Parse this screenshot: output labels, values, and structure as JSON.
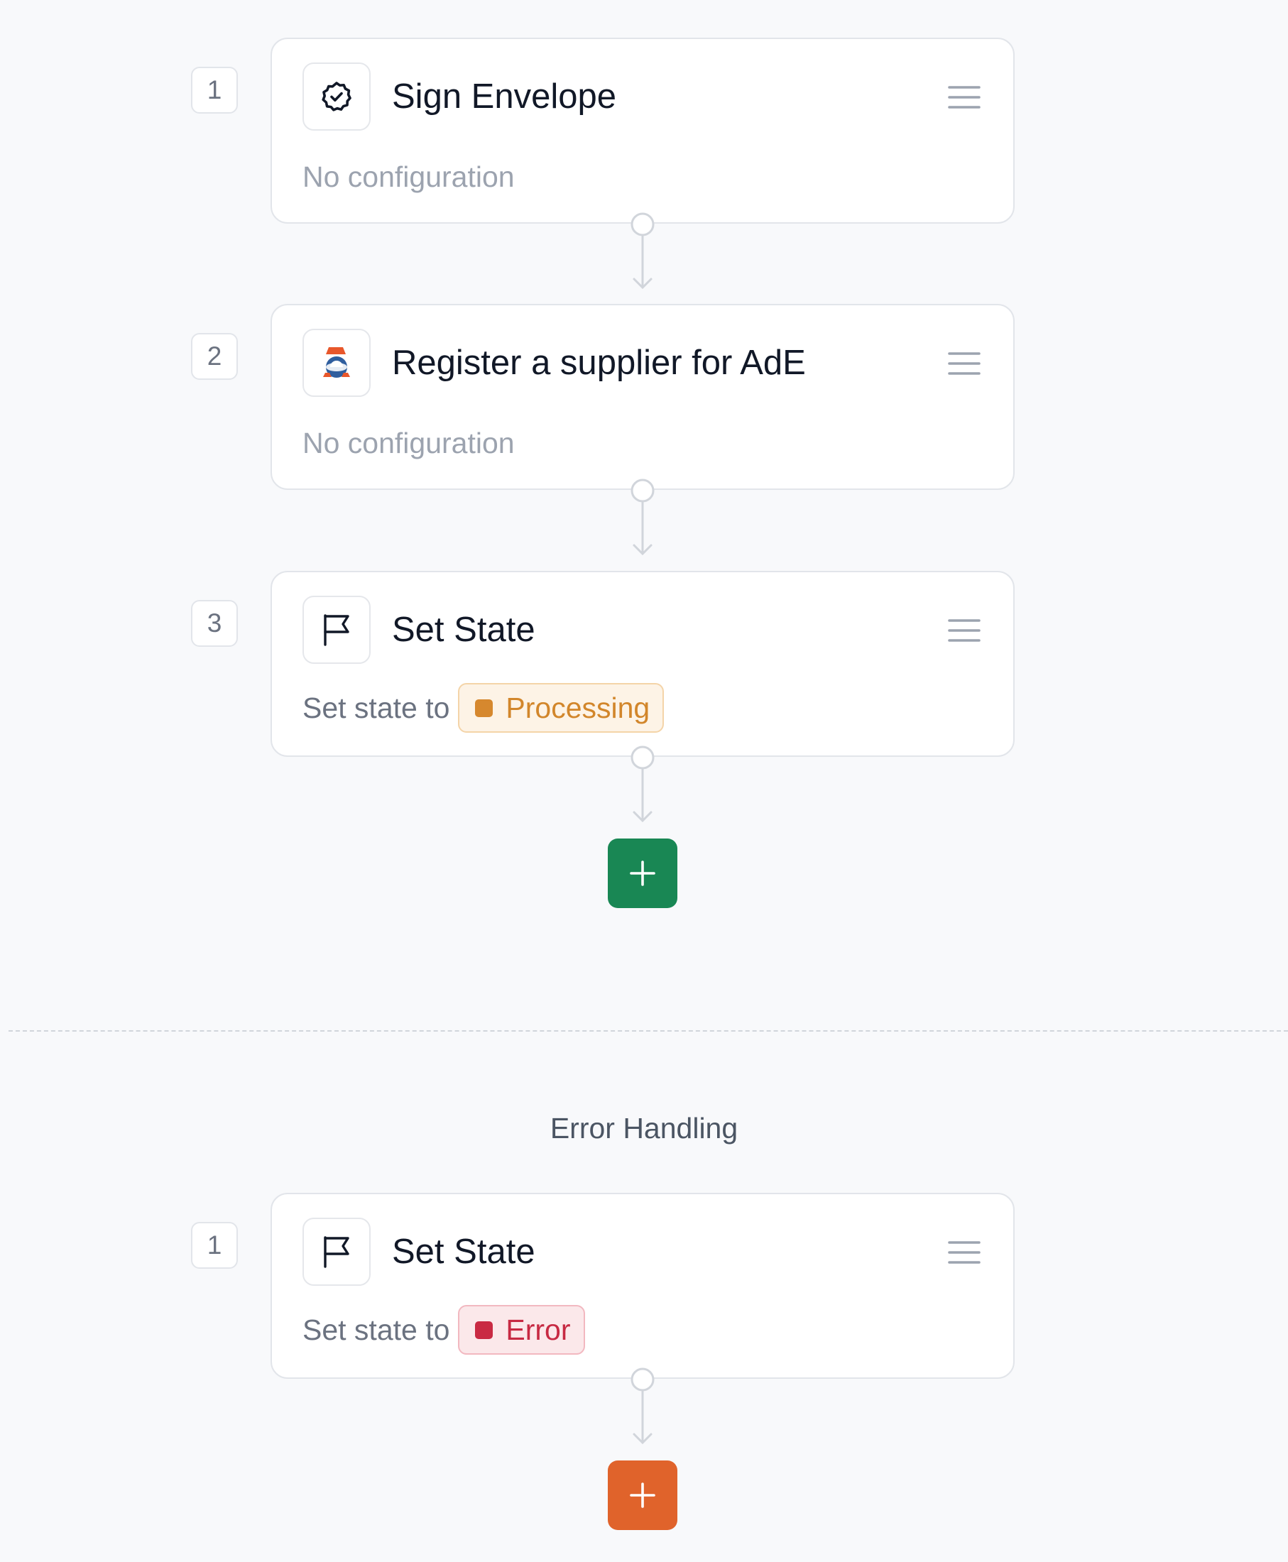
{
  "main_steps": [
    {
      "number": "1",
      "title": "Sign Envelope",
      "icon": "badge-check-icon",
      "subtitle": "No configuration"
    },
    {
      "number": "2",
      "title": "Register a supplier for AdE",
      "icon": "ade-logo-icon",
      "subtitle": "No configuration"
    },
    {
      "number": "3",
      "title": "Set State",
      "icon": "flag-icon",
      "state_label": "Set state to",
      "state_value": "Processing",
      "state_color": "#d6882e"
    }
  ],
  "main_add_button": {
    "icon": "plus-icon",
    "color": "#198754"
  },
  "error_section": {
    "title": "Error Handling",
    "steps": [
      {
        "number": "1",
        "title": "Set State",
        "icon": "flag-icon",
        "state_label": "Set state to",
        "state_value": "Error",
        "state_color": "#c92a43"
      }
    ],
    "add_button": {
      "icon": "plus-icon",
      "color": "#e0632b"
    }
  }
}
